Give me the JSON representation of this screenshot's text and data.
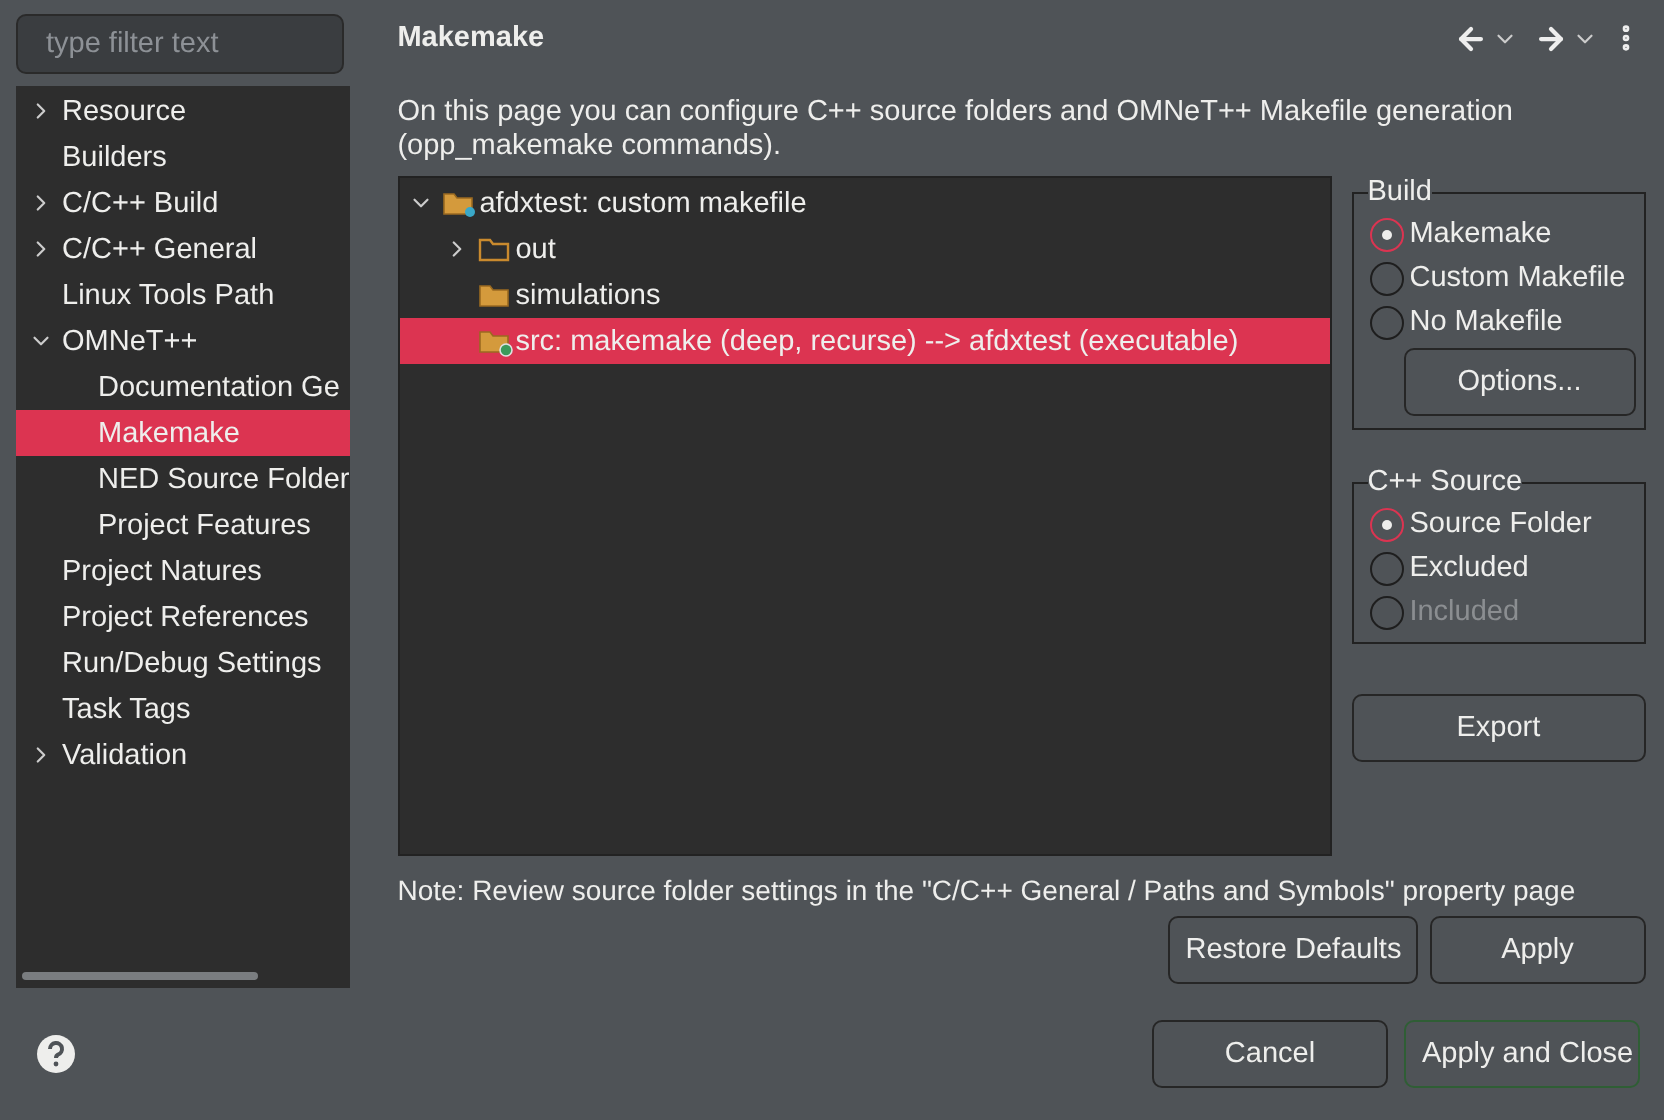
{
  "filter": {
    "placeholder": "type filter text"
  },
  "nav": [
    {
      "label": "Resource",
      "expanded": false,
      "selected": false
    },
    {
      "label": "Builders",
      "selected": false
    },
    {
      "label": "C/C++ Build",
      "expanded": false,
      "selected": false
    },
    {
      "label": "C/C++ General",
      "expanded": false,
      "selected": false
    },
    {
      "label": "Linux Tools Path",
      "selected": false
    },
    {
      "label": "OMNeT++",
      "expanded": true,
      "selected": false,
      "children": [
        {
          "label": "Documentation Ge",
          "selected": false
        },
        {
          "label": "Makemake",
          "selected": true
        },
        {
          "label": "NED Source Folder",
          "selected": false
        },
        {
          "label": "Project Features",
          "selected": false
        }
      ]
    },
    {
      "label": "Project Natures",
      "selected": false
    },
    {
      "label": "Project References",
      "selected": false
    },
    {
      "label": "Run/Debug Settings",
      "selected": false
    },
    {
      "label": "Task Tags",
      "selected": false
    },
    {
      "label": "Validation",
      "expanded": false,
      "selected": false
    }
  ],
  "page": {
    "title": "Makemake",
    "description": "On this page you can configure C++ source folders and OMNeT++ Makefile generation (opp_makemake commands)."
  },
  "folders": [
    {
      "label": "afdxtest: custom makefile",
      "kind": "project",
      "expanded": true,
      "selected": false,
      "children": [
        {
          "label": "out",
          "kind": "folder",
          "expanded": false,
          "selected": false
        },
        {
          "label": "simulations",
          "kind": "open-folder",
          "selected": false
        },
        {
          "label": "src: makemake (deep, recurse) --> afdxtest (executable)",
          "kind": "source-folder",
          "selected": true
        }
      ]
    }
  ],
  "build": {
    "title": "Build",
    "options": [
      {
        "label": "Makemake",
        "selected": true,
        "disabled": false
      },
      {
        "label": "Custom Makefile",
        "selected": false,
        "disabled": false
      },
      {
        "label": "No Makefile",
        "selected": false,
        "disabled": false
      }
    ],
    "options_button": "Options..."
  },
  "source": {
    "title": "C++ Source",
    "options": [
      {
        "label": "Source Folder",
        "selected": true,
        "disabled": false
      },
      {
        "label": "Excluded",
        "selected": false,
        "disabled": false
      },
      {
        "label": "Included",
        "selected": false,
        "disabled": true
      }
    ]
  },
  "export_button": "Export",
  "note": "Note: Review source folder settings in the \"C/C++ General / Paths and Symbols\" property page",
  "page_buttons": [
    "Restore Defaults",
    "Apply"
  ],
  "dialog_buttons": [
    {
      "label": "Cancel",
      "default": false
    },
    {
      "label": "Apply and Close",
      "default": true
    }
  ]
}
